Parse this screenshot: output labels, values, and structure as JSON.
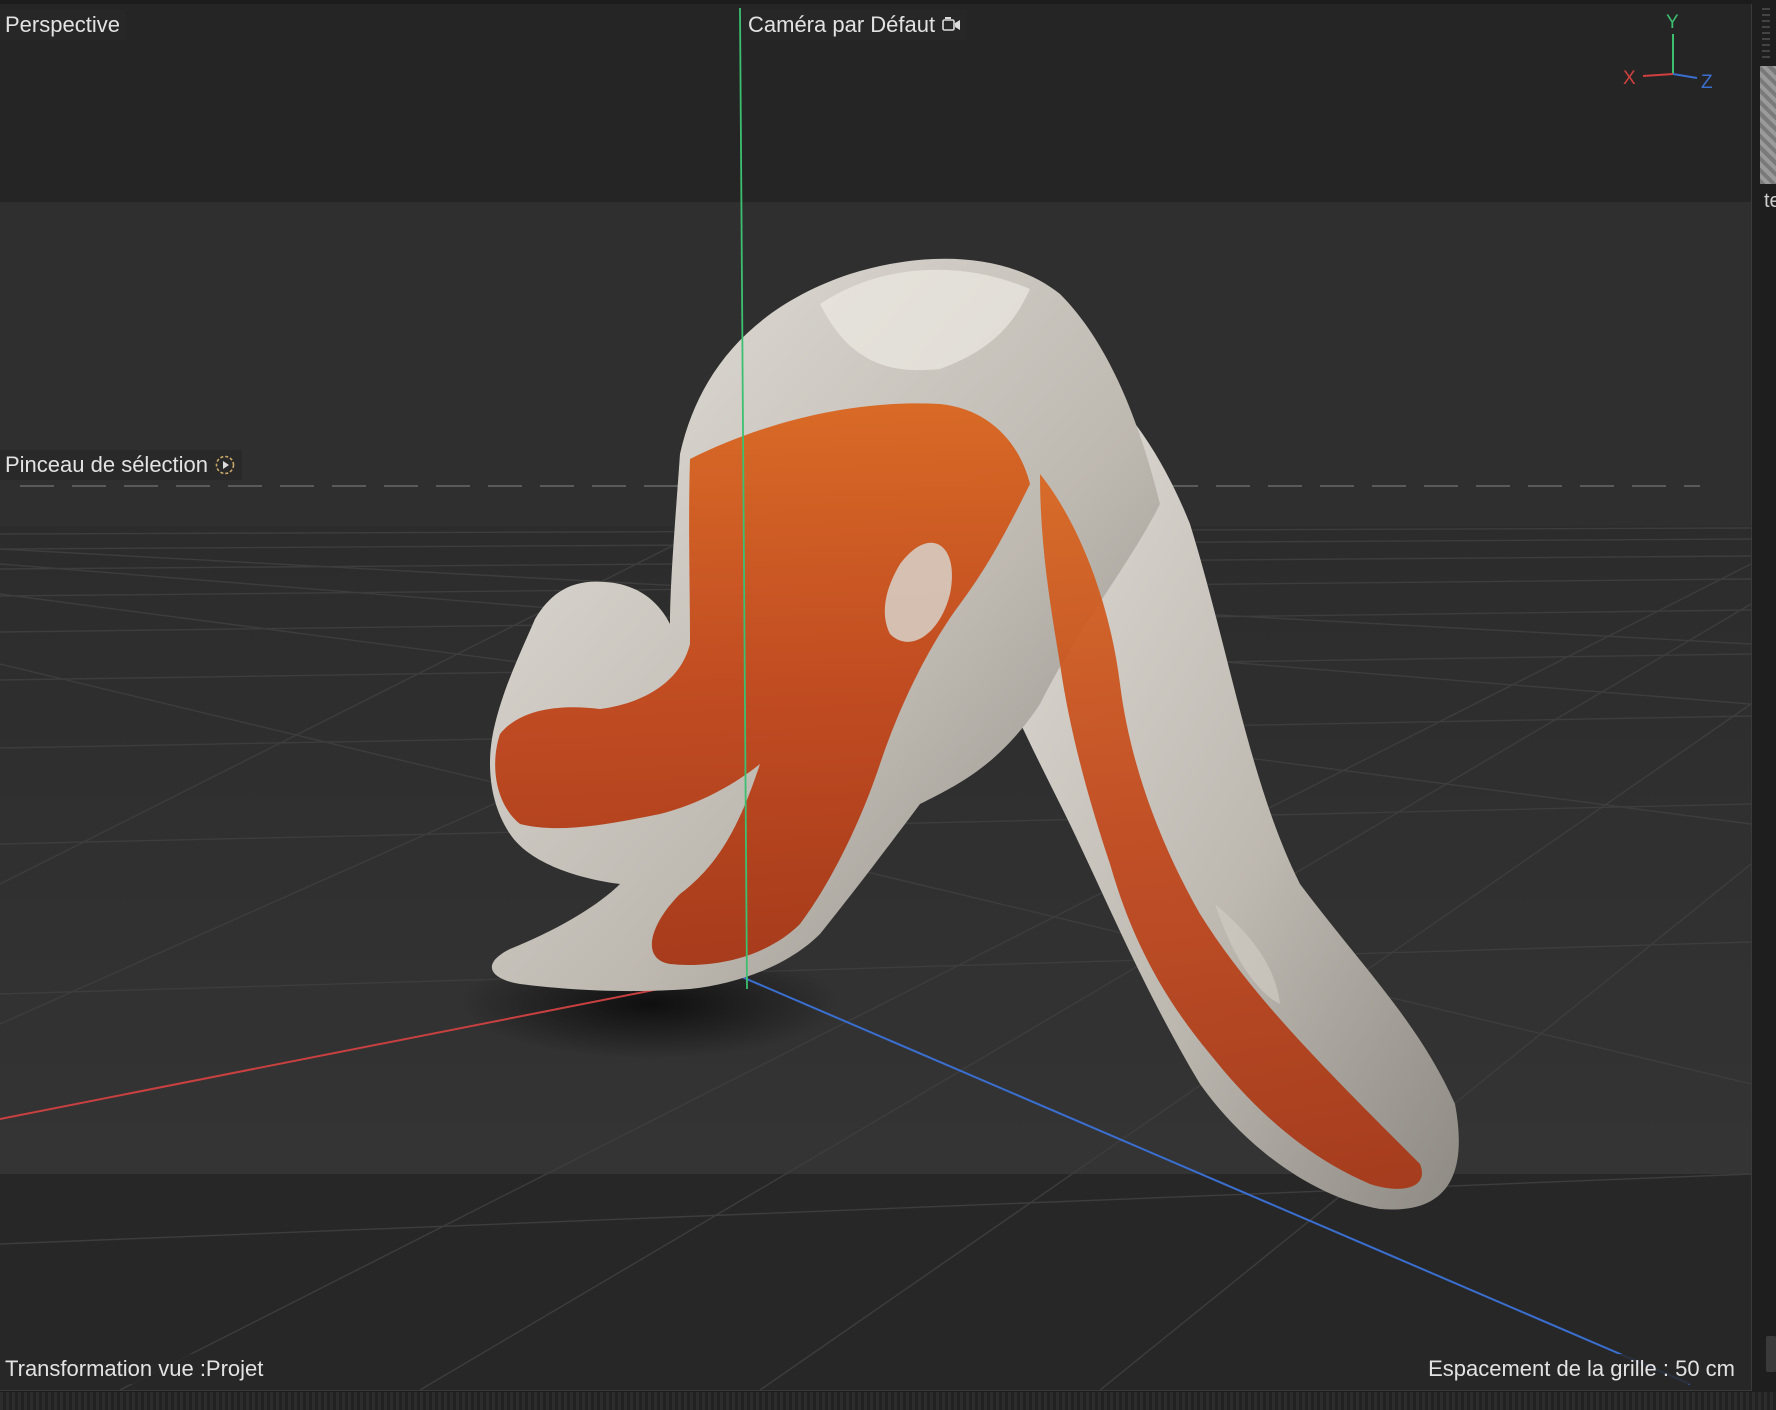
{
  "viewport": {
    "view_name": "Perspective",
    "camera_label": "Caméra par Défaut",
    "tool_label": "Pinceau de sélection",
    "transform_label": "Transformation vue :Projet",
    "grid_spacing_label": "Espacement de la grille : 50 cm"
  },
  "axis_gizmo": {
    "x": "X",
    "y": "Y",
    "z": "Z"
  },
  "right_strip": {
    "partial_text": "te"
  },
  "colors": {
    "background": "#2a2a2a",
    "x_axis": "#d04040",
    "y_axis": "#3cc070",
    "z_axis": "#3a6fd0",
    "model_orange": "#c4531c",
    "model_white": "#d8d4cc"
  }
}
